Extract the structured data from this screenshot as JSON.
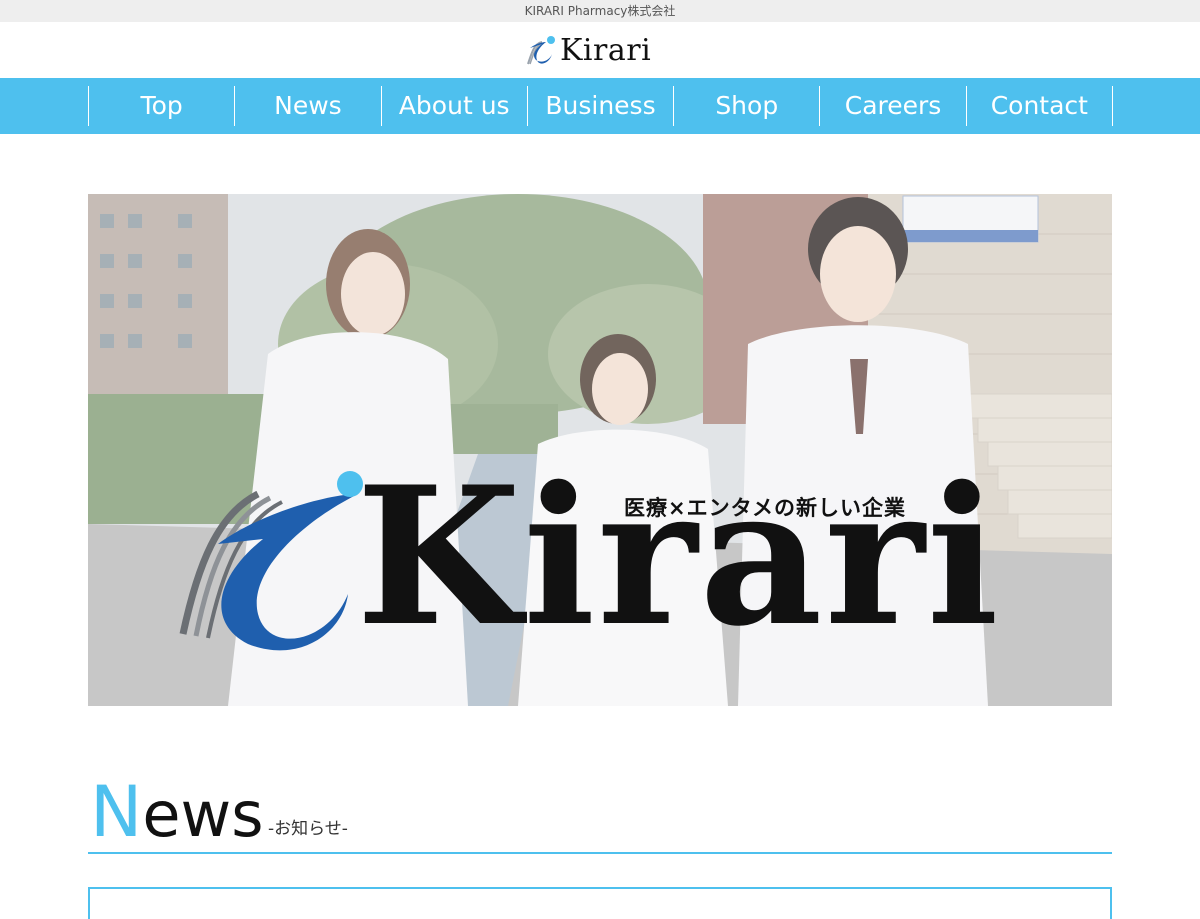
{
  "topbar": {
    "company": "KIRARI Pharmacy株式会社"
  },
  "header": {
    "logo_text": "Kirari",
    "logo_icon": "kirari-swoosh-logo"
  },
  "nav": {
    "items": [
      {
        "label": "Top"
      },
      {
        "label": "News"
      },
      {
        "label": "About us"
      },
      {
        "label": "Business"
      },
      {
        "label": "Shop"
      },
      {
        "label": "Careers"
      },
      {
        "label": "Contact"
      }
    ]
  },
  "hero": {
    "tagline": "医療×エンタメの新しい企業",
    "brand": "Kirari"
  },
  "news": {
    "title_first": "N",
    "title_rest": "ews",
    "subtitle": "-お知らせ-"
  },
  "colors": {
    "accent": "#4ec0ee",
    "logo_blue": "#1f5fae",
    "text": "#111111"
  }
}
